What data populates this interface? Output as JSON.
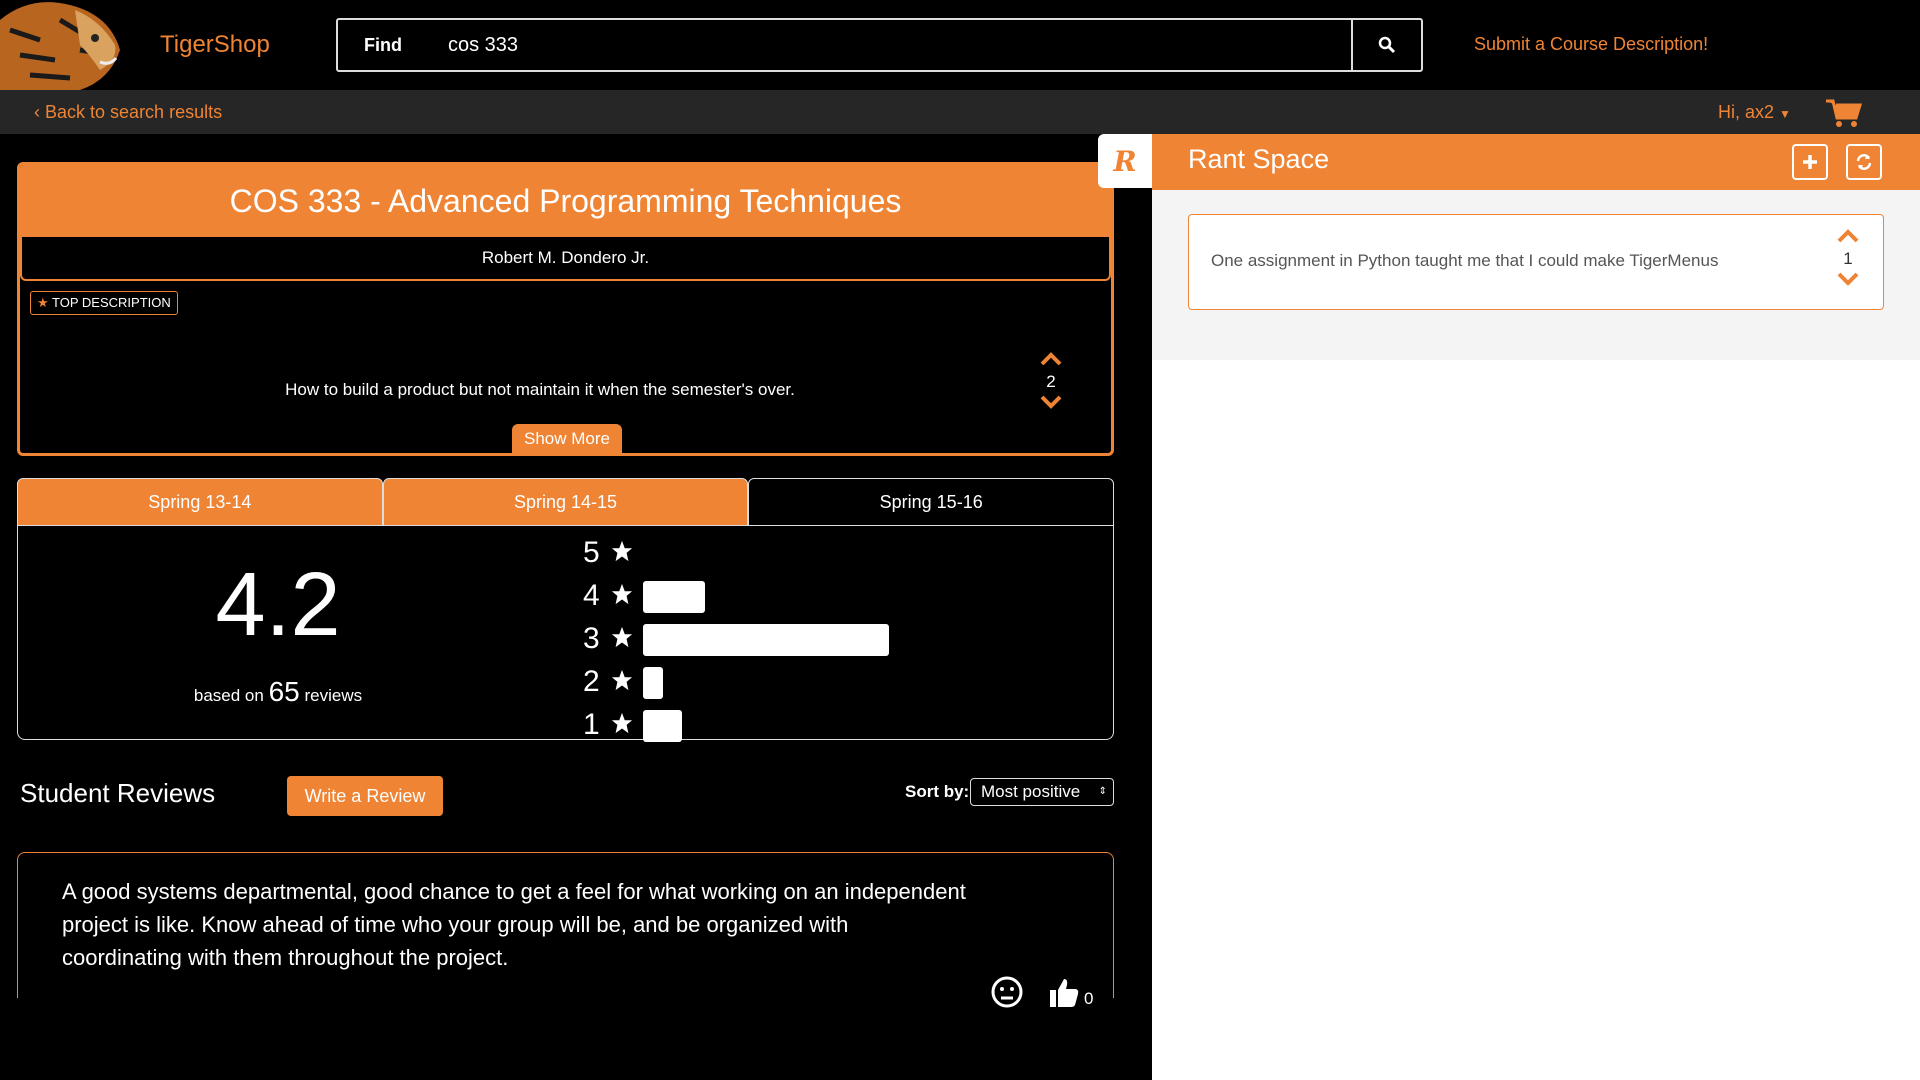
{
  "header": {
    "brand": "TigerShop",
    "search_find_label": "Find",
    "search_query": "cos 333",
    "submit_link": "Submit a Course Description!"
  },
  "subbar": {
    "back_link": "Back to search results",
    "greeting": "Hi, ax2"
  },
  "course": {
    "title": "COS 333 - Advanced Programming Techniques",
    "professor": "Robert M. Dondero Jr.",
    "badge_label": "TOP DESCRIPTION",
    "top_description": "How to build a product but not maintain it when the semester's over.",
    "description_votes": "2",
    "show_more_label": "Show More"
  },
  "terms": {
    "tabs": [
      "Spring 13-14",
      "Spring 14-15",
      "Spring 15-16"
    ],
    "active_index": 2
  },
  "rating": {
    "average": "4.2",
    "based_on_prefix": "based on",
    "review_count": "65",
    "based_on_suffix": "reviews",
    "distribution": [
      {
        "stars": "5",
        "fraction": 0.0
      },
      {
        "stars": "4",
        "fraction": 0.25
      },
      {
        "stars": "3",
        "fraction": 1.0
      },
      {
        "stars": "2",
        "fraction": 0.08
      },
      {
        "stars": "1",
        "fraction": 0.16
      }
    ]
  },
  "reviews": {
    "section_title": "Student Reviews",
    "write_button": "Write a Review",
    "sort_label": "Sort by:",
    "sort_value": "Most positive",
    "items": [
      {
        "text": "A good systems departmental, good chance to get a feel for what working on an independent project is like. Know ahead of time who your group will be, and be organized with coordinating with them throughout the project.",
        "likes": "0"
      }
    ]
  },
  "rant": {
    "title": "Rant Space",
    "logo_letter": "R",
    "items": [
      {
        "text": "One assignment in Python taught me that I could make TigerMenus",
        "votes": "1"
      }
    ]
  },
  "colors": {
    "accent": "#ee8434",
    "background": "#000000",
    "panel": "#ffffff"
  },
  "icons": [
    "tiger-logo",
    "search-icon",
    "chevron-left-icon",
    "caret-down-icon",
    "cart-icon",
    "star-icon",
    "chevron-up-icon",
    "chevron-down-icon",
    "plus-icon",
    "refresh-icon",
    "neutral-face-icon",
    "thumbs-up-icon"
  ]
}
